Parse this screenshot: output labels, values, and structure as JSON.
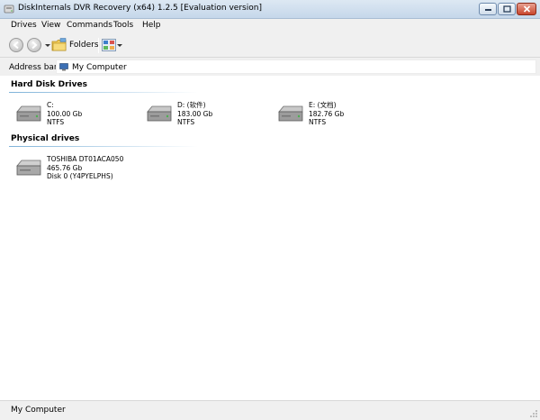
{
  "window": {
    "title": "DiskInternals DVR Recovery (x64) 1.2.5 [Evaluation version]"
  },
  "menu": {
    "items": [
      "Drives",
      "View",
      "Commands",
      "Tools",
      "Help"
    ]
  },
  "toolbar": {
    "folders_label": "Folders"
  },
  "address": {
    "label": "Address bar:",
    "value": "My Computer"
  },
  "sections": {
    "hard_disk_drives": "Hard Disk Drives",
    "physical_drives": "Physical drives"
  },
  "drives": [
    {
      "name": "C:",
      "size": "100.00 Gb",
      "fs": "NTFS"
    },
    {
      "name": "D: (软件)",
      "size": "183.00 Gb",
      "fs": "NTFS"
    },
    {
      "name": "E: (文档)",
      "size": "182.76 Gb",
      "fs": "NTFS"
    }
  ],
  "physical": [
    {
      "model": "TOSHIBA DT01ACA050",
      "size": "465.76 Gb",
      "disk": "Disk 0 (Y4PYELPHS)"
    }
  ],
  "status": {
    "text": "My Computer"
  },
  "colors": {
    "accent_line": "#7fb3d9",
    "titlebar": "#c5d7ea",
    "close_button": "#c8452c"
  }
}
